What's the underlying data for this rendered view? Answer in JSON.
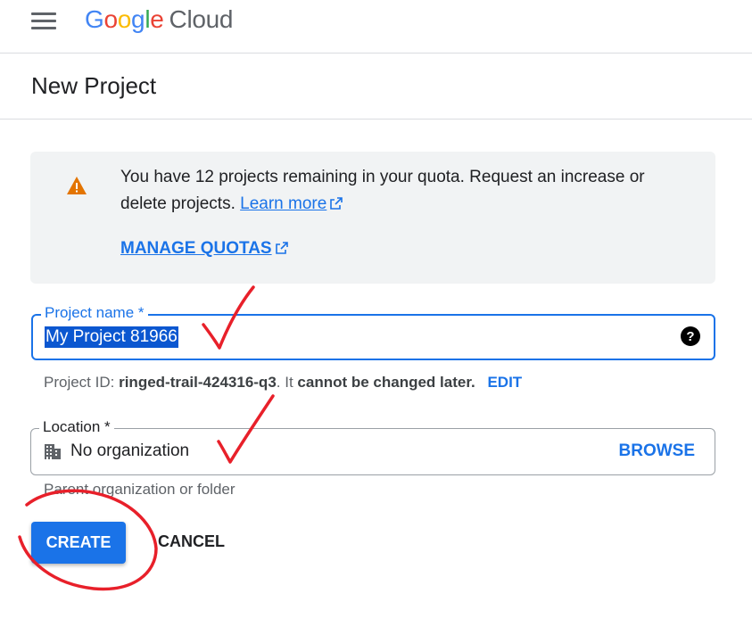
{
  "header": {
    "logo_letters": [
      {
        "ch": "G",
        "color": "#4285F4"
      },
      {
        "ch": "o",
        "color": "#EA4335"
      },
      {
        "ch": "o",
        "color": "#FBBC05"
      },
      {
        "ch": "g",
        "color": "#4285F4"
      },
      {
        "ch": "l",
        "color": "#34A853"
      },
      {
        "ch": "e",
        "color": "#EA4335"
      }
    ],
    "logo_suffix": "Cloud",
    "menu_icon": "hamburger-menu-icon"
  },
  "page": {
    "title": "New Project"
  },
  "quota_notice": {
    "icon": "warning-icon",
    "text": "You have 12 projects remaining in your quota. Request an increase or delete projects.",
    "learn_more": "Learn more",
    "manage_quotas": "MANAGE QUOTAS"
  },
  "project_name": {
    "label": "Project name *",
    "value": "My Project 81966",
    "help_icon": "help-icon"
  },
  "project_id": {
    "prefix": "Project ID: ",
    "id": "ringed-trail-424316-q3",
    "middle": ". It ",
    "emphasis": "cannot be changed later.",
    "edit_label": "EDIT"
  },
  "location": {
    "label": "Location *",
    "value": "No organization",
    "browse_label": "BROWSE",
    "hint": "Parent organization or folder",
    "icon": "building-icon"
  },
  "actions": {
    "create_label": "CREATE",
    "cancel_label": "CANCEL"
  },
  "colors": {
    "accent": "#1a73e8",
    "warning": "#e37400",
    "annotation": "#e8202a"
  }
}
